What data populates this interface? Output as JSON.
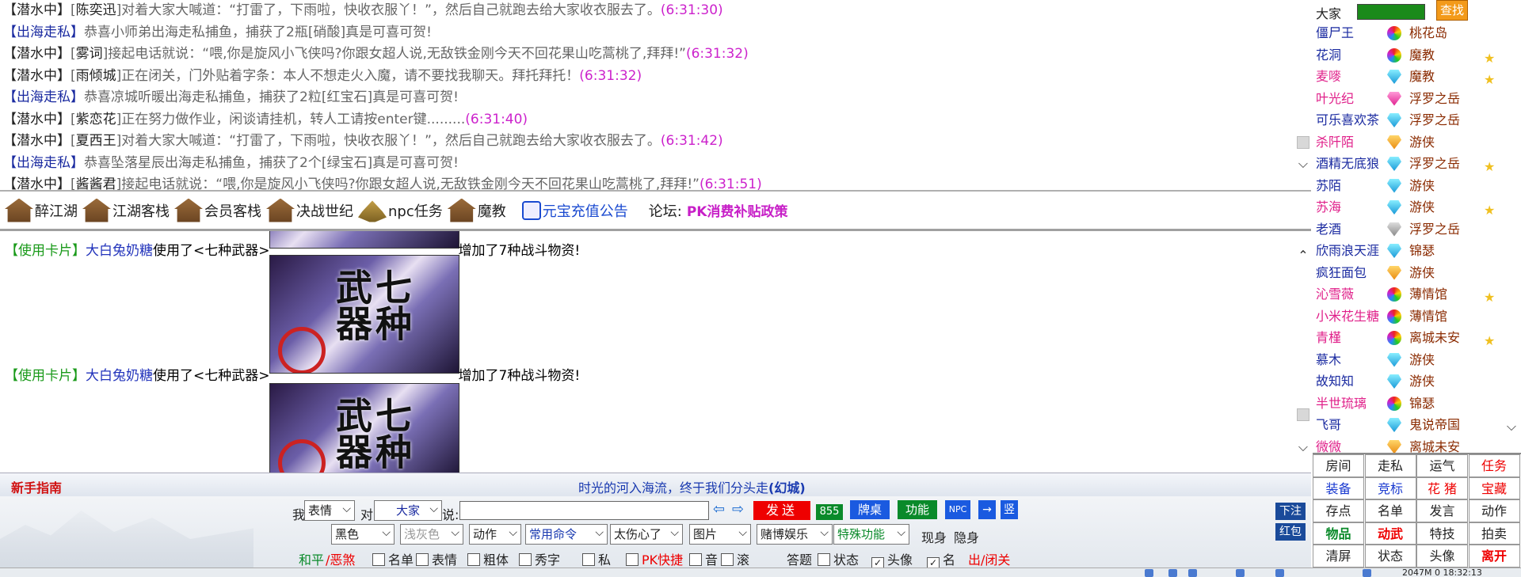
{
  "top_chat": [
    {
      "tag": "【潜水中】",
      "tag_color": "#222",
      "parts": [
        {
          "t": "[",
          "c": "gray"
        },
        {
          "t": "陈奕迅",
          "c": "name"
        },
        {
          "t": "]对着大家大喊道：“打雷了，下雨啦，快收衣服丫！”，然后自己就跑去给大家收衣服去了。",
          "c": "gray"
        },
        {
          "t": "(6:31:30)",
          "c": "time"
        }
      ]
    },
    {
      "tag": "【出海走私】",
      "tag_color": "blue",
      "parts": [
        {
          "t": "恭喜小师弟出海走私捕鱼，捕获了2瓶[硝酸]真是可喜可贺!",
          "c": "gray"
        }
      ]
    },
    {
      "tag": "【潜水中】",
      "tag_color": "#222",
      "parts": [
        {
          "t": "[",
          "c": "gray"
        },
        {
          "t": "雾词",
          "c": "name"
        },
        {
          "t": "]接起电话就说：“喂,你是旋风小飞侠吗?你跟女超人说,无敌铁金刚今天不回花果山吃蒿桃了,拜拜!”",
          "c": "gray"
        },
        {
          "t": "(6:31:32)",
          "c": "time"
        }
      ]
    },
    {
      "tag": "【潜水中】",
      "tag_color": "#222",
      "parts": [
        {
          "t": "[",
          "c": "gray"
        },
        {
          "t": "雨倾城",
          "c": "name"
        },
        {
          "t": "]正在闭关，门外贴着字条：本人不想走火入魔，请不要找我聊天。拜托拜托！",
          "c": "gray"
        },
        {
          "t": "(6:31:32)",
          "c": "time"
        }
      ]
    },
    {
      "tag": "【出海走私】",
      "tag_color": "blue",
      "parts": [
        {
          "t": "恭喜凉城听暖出海走私捕鱼，捕获了2粒[红宝石]真是可喜可贺!",
          "c": "gray"
        }
      ]
    },
    {
      "tag": "【潜水中】",
      "tag_color": "#222",
      "parts": [
        {
          "t": "[",
          "c": "gray"
        },
        {
          "t": "紫恋花",
          "c": "name"
        },
        {
          "t": "]正在努力做作业，闲谈请挂机，转人工请按enter键.........",
          "c": "gray"
        },
        {
          "t": "(6:31:40)",
          "c": "time"
        }
      ]
    },
    {
      "tag": "【潜水中】",
      "tag_color": "#222",
      "parts": [
        {
          "t": "[",
          "c": "gray"
        },
        {
          "t": "夏西王",
          "c": "name"
        },
        {
          "t": "]对着大家大喊道：“打雷了，下雨啦，快收衣服丫！”，然后自己就跑去给大家收衣服去了。",
          "c": "gray"
        },
        {
          "t": "(6:31:42)",
          "c": "time"
        }
      ]
    },
    {
      "tag": "【出海走私】",
      "tag_color": "blue",
      "parts": [
        {
          "t": "恭喜坠落星辰出海走私捕鱼，捕获了2个[绿宝石]真是可喜可贺!",
          "c": "gray"
        }
      ]
    },
    {
      "tag": "【潜水中】",
      "tag_color": "#222",
      "parts": [
        {
          "t": "[",
          "c": "gray"
        },
        {
          "t": "酱酱君",
          "c": "name"
        },
        {
          "t": "]接起电话就说：“喂,你是旋风小飞侠吗?你跟女超人说,无敌铁金刚今天不回花果山吃蒿桃了,拜拜!”",
          "c": "gray"
        },
        {
          "t": "(6:31:51)",
          "c": "time"
        }
      ]
    }
  ],
  "nav": {
    "items": [
      "醉江湖",
      "江湖客栈",
      "会员客栈",
      "决战世纪",
      "npc任务",
      "魔教"
    ],
    "notice": "元宝充值公告",
    "forum_label": "论坛:",
    "forum_link": "PK消费补贴政策"
  },
  "cards": {
    "tag": "【使用卡片】",
    "user": "大白兔奶糖",
    "used": "使用了<七种武器>",
    "result": "增加了7种战斗物资!",
    "poster_title": "七种武器"
  },
  "guide": {
    "label": "新手指南",
    "motto_pre": "时光的河入海流，终于我们分头走",
    "motto_author": "(幻城)"
  },
  "controls": {
    "me": "我",
    "expr": "表情",
    "to": "对",
    "target": "大家",
    "say": "说:",
    "send": "发送",
    "count": "855",
    "table_btn": "牌桌",
    "func_btn": "功能",
    "npc_btn": "NPC",
    "arrow_btn": "→",
    "vert_btn": "竖",
    "row2": [
      "黑色",
      "浅灰色",
      "动作",
      "常用命令",
      "太伤心了",
      "图片",
      "赌博娱乐",
      "特殊功能"
    ],
    "show": "现身",
    "hide": "隐身",
    "peace": "和平",
    "evil": "/恶煞",
    "checks": [
      {
        "label": "名单",
        "on": false
      },
      {
        "label": "表情",
        "on": false
      },
      {
        "label": "粗体",
        "on": false
      },
      {
        "label": "秀字",
        "on": false
      },
      {
        "label": "私",
        "on": false
      },
      {
        "label": "PK快捷",
        "on": false
      },
      {
        "label": "音",
        "on": false
      },
      {
        "label": "滚",
        "on": false
      }
    ],
    "answer": "答题",
    "checks2": [
      {
        "label": "状态",
        "on": false
      },
      {
        "label": "头像",
        "on": true
      },
      {
        "label": "名",
        "on": true
      }
    ],
    "exit": "出/闭关",
    "side_btns": [
      "下注",
      "红包"
    ]
  },
  "right_panel": {
    "room": "大家",
    "find": "查找",
    "users": [
      {
        "name": "僵尸王",
        "color": "#1a2aa0",
        "gem": "multi",
        "group": "桃花岛",
        "star": false
      },
      {
        "name": "花洞",
        "color": "#1a2aa0",
        "gem": "multi",
        "group": "魔教",
        "star": true
      },
      {
        "name": "麦嘜",
        "color": "#e0208a",
        "gem": "blue",
        "group": "魔教",
        "star": true
      },
      {
        "name": "叶光纪",
        "color": "#e0208a",
        "gem": "pink",
        "group": "浮罗之岳",
        "star": false
      },
      {
        "name": "可乐喜欢茶",
        "color": "#1a2aa0",
        "gem": "blue",
        "group": "浮罗之岳",
        "star": false
      },
      {
        "name": "杀阡陌",
        "color": "#e0208a",
        "gem": "gold",
        "group": "游侠",
        "star": false
      },
      {
        "name": "酒精无底狼",
        "color": "#1a2aa0",
        "gem": "blue",
        "group": "浮罗之岳",
        "star": true
      },
      {
        "name": "苏陌",
        "color": "#1a2aa0",
        "gem": "blue",
        "group": "游侠",
        "star": false
      },
      {
        "name": "苏海",
        "color": "#e0208a",
        "gem": "blue",
        "group": "游侠",
        "star": true
      },
      {
        "name": "老酒",
        "color": "#1a2aa0",
        "gem": "gray",
        "group": "浮罗之岳",
        "star": false
      },
      {
        "name": "欣雨浪天涯",
        "color": "#1a2aa0",
        "gem": "blue",
        "group": "锦瑟",
        "star": false
      },
      {
        "name": "疯狂面包",
        "color": "#1a2aa0",
        "gem": "gold",
        "group": "游侠",
        "star": false
      },
      {
        "name": "沁雪薇",
        "color": "#e0208a",
        "gem": "multi",
        "group": "薄情馆",
        "star": true
      },
      {
        "name": "小米花生糖",
        "color": "#e0208a",
        "gem": "multi",
        "group": "薄情馆",
        "star": false
      },
      {
        "name": "青槿",
        "color": "#e0208a",
        "gem": "multi",
        "group": "离城未安",
        "star": true
      },
      {
        "name": "慕木",
        "color": "#1a2aa0",
        "gem": "blue",
        "group": "游侠",
        "star": false
      },
      {
        "name": "故知知",
        "color": "#1a2aa0",
        "gem": "blue",
        "group": "游侠",
        "star": false
      },
      {
        "name": "半世琉璃",
        "color": "#e0208a",
        "gem": "multi",
        "group": "锦瑟",
        "star": false
      },
      {
        "name": "飞哥",
        "color": "#1a2aa0",
        "gem": "blue",
        "group": "鬼说帝国",
        "star": false
      },
      {
        "name": "微微",
        "color": "#e0208a",
        "gem": "gold",
        "group": "离城未安",
        "star": false
      }
    ]
  },
  "grid": [
    {
      "t": "房间",
      "c": "dark"
    },
    {
      "t": "走私",
      "c": "dark"
    },
    {
      "t": "运气",
      "c": "dark"
    },
    {
      "t": "任务",
      "c": "red"
    },
    {
      "t": "装备",
      "c": "blue"
    },
    {
      "t": "竞标",
      "c": "blue"
    },
    {
      "t": "花 猪",
      "c": "red"
    },
    {
      "t": "宝藏",
      "c": "red"
    },
    {
      "t": "存点",
      "c": "dark"
    },
    {
      "t": "名单",
      "c": "dark"
    },
    {
      "t": "发言",
      "c": "dark"
    },
    {
      "t": "动作",
      "c": "dark"
    },
    {
      "t": "物品",
      "c": "green"
    },
    {
      "t": "动武",
      "c": "redb"
    },
    {
      "t": "特技",
      "c": "dark"
    },
    {
      "t": "拍卖",
      "c": "dark"
    },
    {
      "t": "清屏",
      "c": "dark"
    },
    {
      "t": "状态",
      "c": "dark"
    },
    {
      "t": "头像",
      "c": "dark"
    },
    {
      "t": "离开",
      "c": "redb"
    }
  ],
  "status_text": "2047M 0 18:32:13"
}
